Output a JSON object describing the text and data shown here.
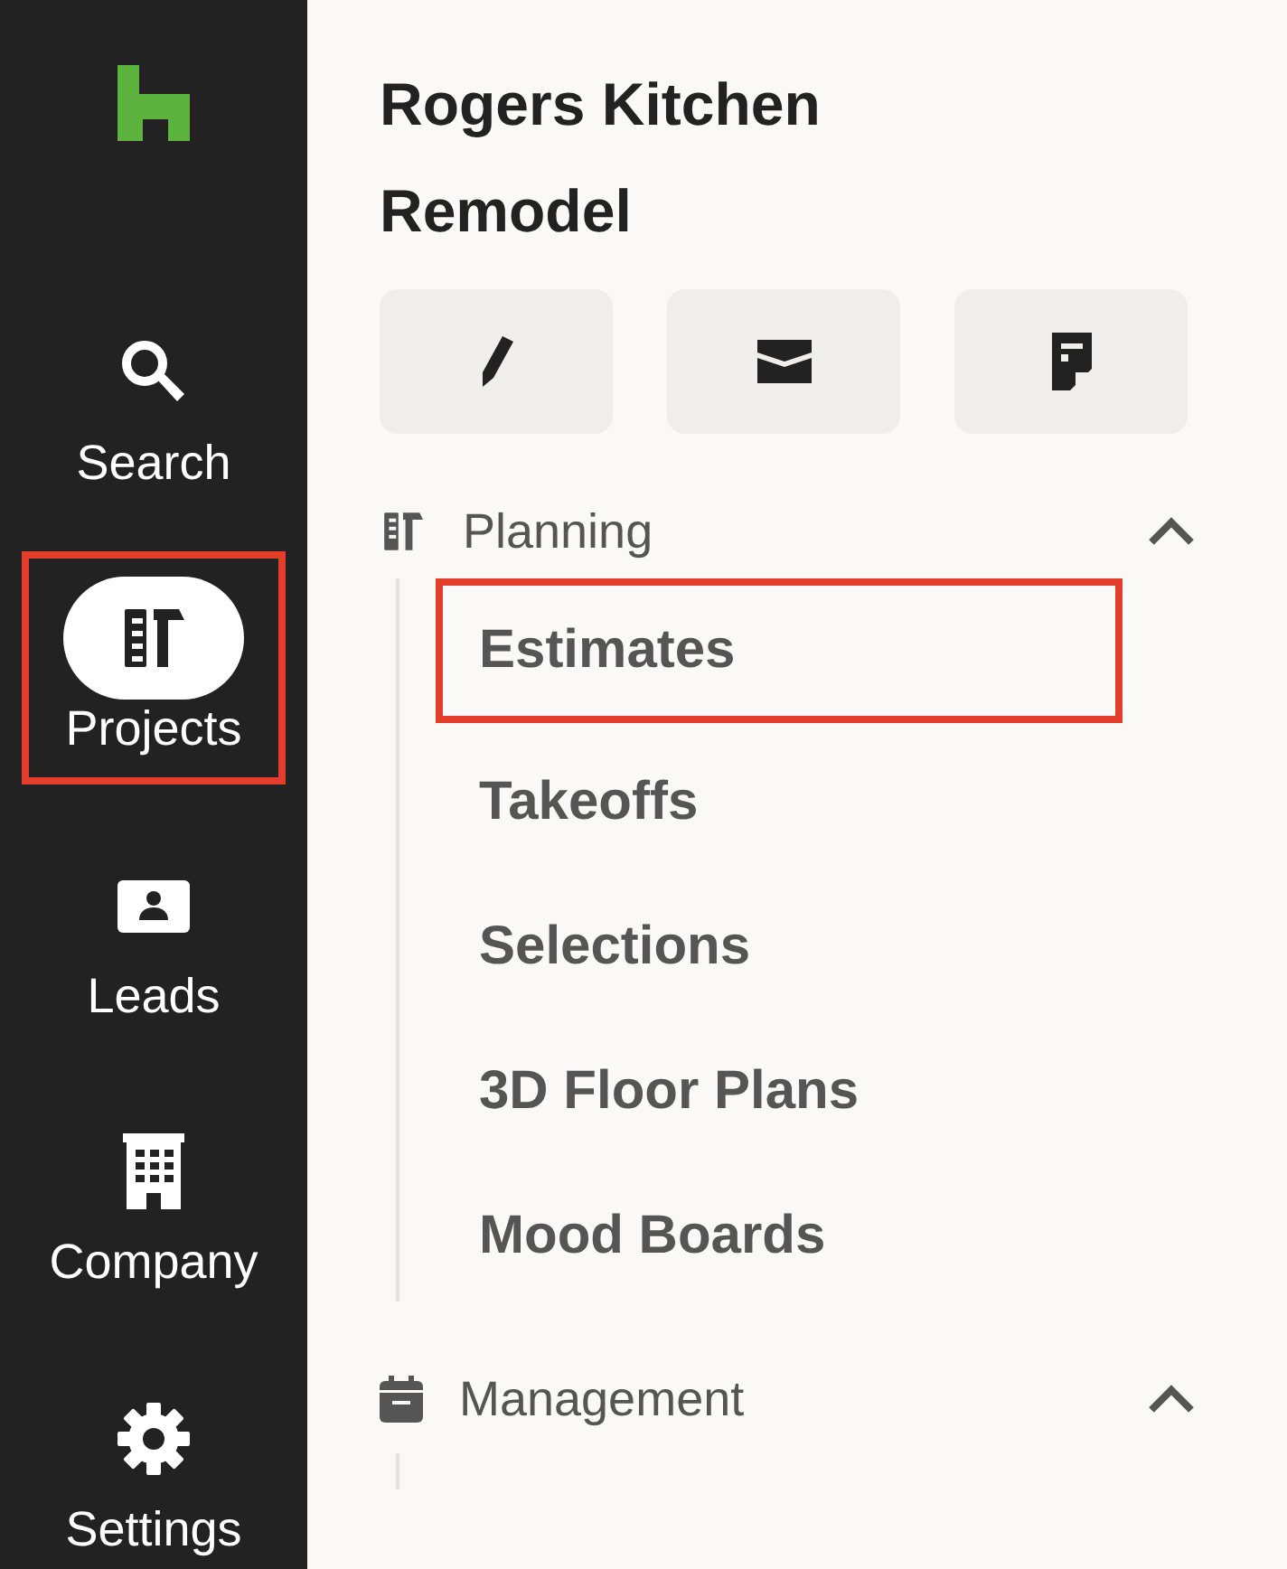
{
  "rail": {
    "items": [
      {
        "kind": "search",
        "label": "Search",
        "selected": false,
        "highlighted": false
      },
      {
        "kind": "projects",
        "label": "Projects",
        "selected": true,
        "highlighted": true
      },
      {
        "kind": "leads",
        "label": "Leads",
        "selected": false,
        "highlighted": false
      },
      {
        "kind": "company",
        "label": "Company",
        "selected": false,
        "highlighted": false
      },
      {
        "kind": "settings",
        "label": "Settings",
        "selected": false,
        "highlighted": false
      }
    ]
  },
  "project": {
    "title": "Rogers Kitchen Remodel",
    "actions": [
      {
        "kind": "edit"
      },
      {
        "kind": "message"
      },
      {
        "kind": "notes"
      }
    ]
  },
  "sections": [
    {
      "kind": "planning",
      "label": "Planning",
      "expanded": true,
      "items": [
        {
          "label": "Estimates",
          "highlighted": true
        },
        {
          "label": "Takeoffs",
          "highlighted": false
        },
        {
          "label": "Selections",
          "highlighted": false
        },
        {
          "label": "3D Floor Plans",
          "highlighted": false
        },
        {
          "label": "Mood Boards",
          "highlighted": false
        }
      ]
    },
    {
      "kind": "management",
      "label": "Management",
      "expanded": true
    }
  ]
}
